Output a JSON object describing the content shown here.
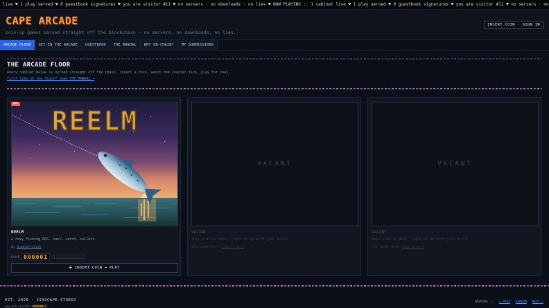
{
  "ticker": "live ♥ 1 play served ♥ 0 guestbook signatures ♥ you are visitor #11 ♥ no servers · no downloads · no lies ♥ NOW PLAYING :: 1 cabinet live ♥ 1 play served ♥ 0 guestbook signatures ♥ you are visitor #11 ♥ no servers · no downloads · no lies",
  "brand": {
    "title": "CAPE ARCADE",
    "subtitle": "coin-op games served straight off the blockchain — no servers, no downloads, no lies.",
    "signin": "INSERT COIN · SIGN IN"
  },
  "nav": [
    "ARCADE FLOOR",
    "GET IN THE ARCADE",
    "GUESTBOOK",
    "THE MANUAL",
    "WHY ON-CHAIN?",
    "MY SUBMISSIONS"
  ],
  "page": {
    "title": "THE ARCADE FLOOR",
    "intro": "every cabinet below is served straight off the chain. insert a coin, watch the counter tick, play for real.",
    "manual_link": "first time on the floor? read THE MANUAL →"
  },
  "cabinets": [
    {
      "badge": "NEW",
      "art_title": "REELM",
      "title": "REELM",
      "desc": "a cozy fishing RPG. cast, catch, collect.",
      "by_prefix": "by",
      "author": "@iamsofrivity",
      "plays_label": "PLAYS",
      "plays": "000001",
      "button": "▶ INSERT COIN → PLAY"
    },
    {
      "screen": "VACANT",
      "title": "VACANT",
      "desc": "this slot is dark. light it up with your build.",
      "cta_prefix": "your game here?",
      "cta_link": "slip it in →"
    },
    {
      "screen": "VACANT",
      "title": "VACANT",
      "desc": "this slot is dark. light it up with your build.",
      "cta_prefix": "your game here?",
      "cta_link": "slip it in →"
    }
  ],
  "footer": {
    "est": "EST. 2026 · 1933CAPE STUDIO",
    "visitor_prefix": "you are visitor #",
    "visitor_count": "00000011",
    "webring_label": "WEBRING ::",
    "prev": "« PREV",
    "random": "RANDOM",
    "next": "NEXT »"
  },
  "colors": {
    "accent": "#2563eb",
    "brand": "#ff9a3c",
    "counter": "#ffb020",
    "link": "#4d8dff",
    "stripe_pink": "#e040a0",
    "stripe_cyan": "#2ec4d6"
  }
}
